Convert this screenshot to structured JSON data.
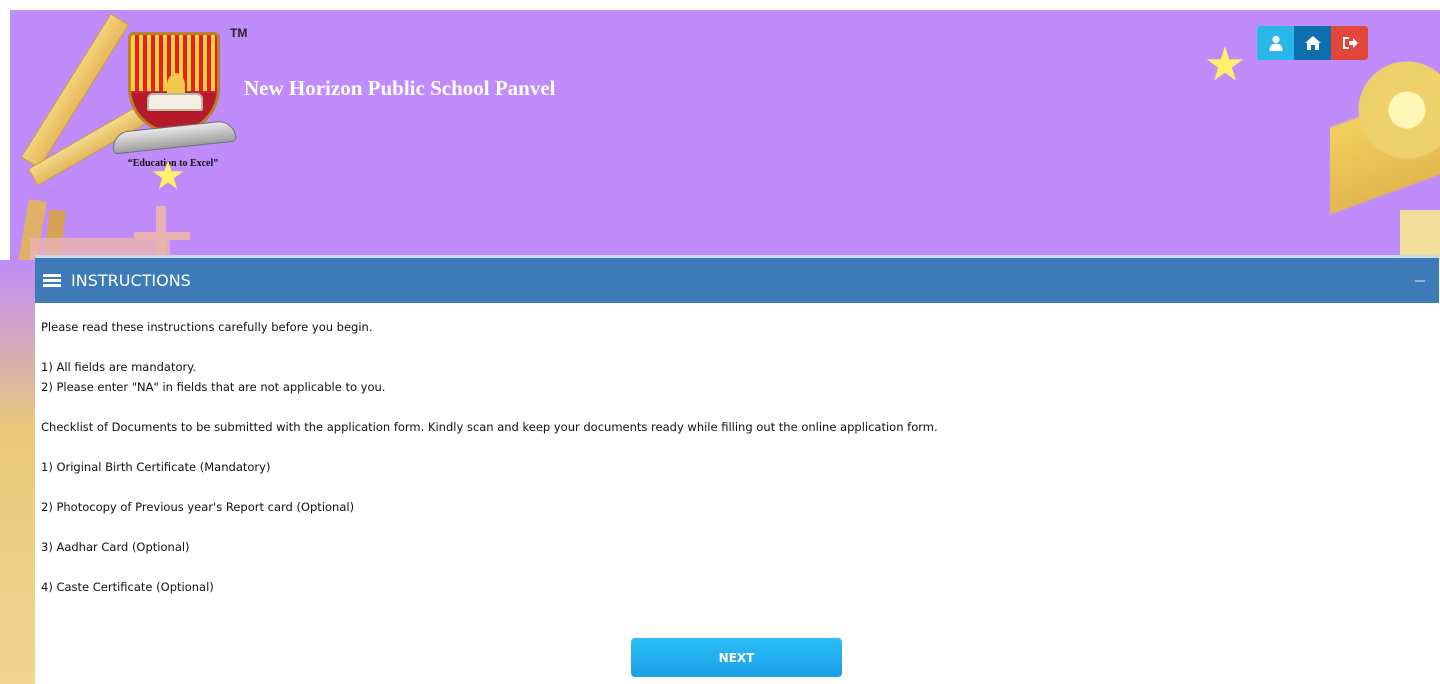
{
  "header": {
    "school_name": "New Horizon Public School Panvel",
    "logo": {
      "trademark": "TM",
      "motto": "“Education to Excel”"
    },
    "background_color": "#c08cfb",
    "actions": {
      "user_icon": "user-icon",
      "home_icon": "home-icon",
      "logout_icon": "sign-out-icon"
    }
  },
  "panel": {
    "title": "INSTRUCTIONS",
    "header_color": "#3c7bb7",
    "intro": "Please read these instructions carefully before you begin.",
    "rules": [
      "1) All fields are mandatory.",
      "2) Please enter \"NA\" in fields that are not applicable to you."
    ],
    "checklist_intro": "Checklist of Documents to be submitted with the application form. Kindly scan and keep your documents ready while filling out the online application form.",
    "documents": [
      "1) Original Birth Certificate (Mandatory)",
      "2) Photocopy of Previous year's Report card (Optional)",
      "3) Aadhar Card (Optional)",
      "4) Caste Certificate (Optional)"
    ],
    "next_label": "NEXT"
  }
}
